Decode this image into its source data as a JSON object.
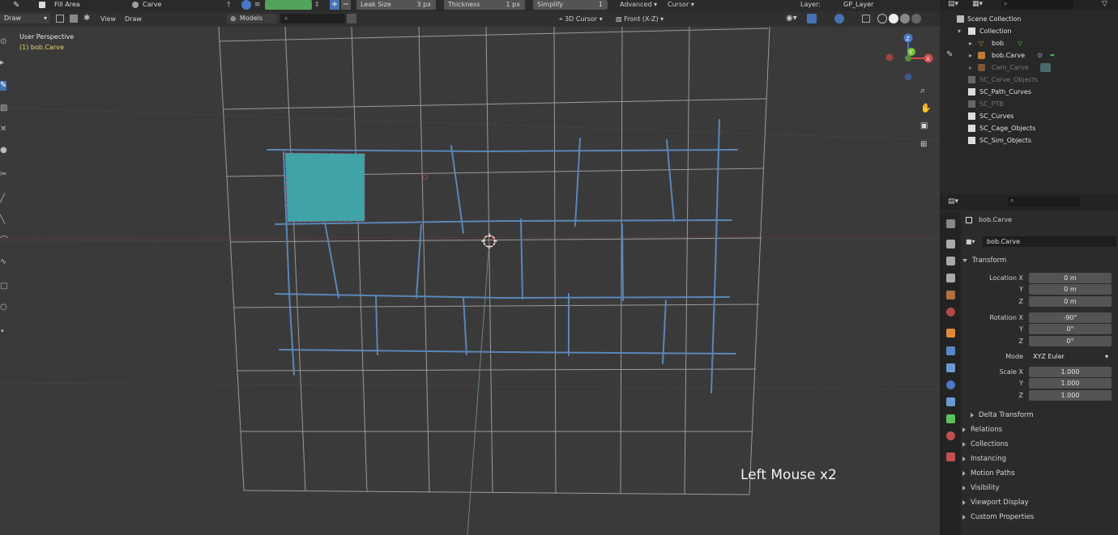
{
  "header": {
    "mode": "Draw",
    "fill_tool": "Fill Area",
    "material": "Carve",
    "leak_size_label": "Leak Size",
    "leak_size_value": "3 px",
    "thickness_label": "Thickness",
    "thickness_value": "1 px",
    "simplify_label": "Simplify",
    "simplify_value": "1",
    "advanced": "Advanced",
    "cursor": "Cursor",
    "layer_label": "Layer:",
    "layer_value": "GP_Layer",
    "fill_color": "#53a35a",
    "menus": [
      "View",
      "Draw"
    ],
    "models": "Models",
    "cursor_3d": "3D Cursor",
    "front_view": "Front (X-Z)"
  },
  "viewport": {
    "perspective": "User Perspective",
    "object": "(1) bob.Carve",
    "hint": "Left Mouse x2",
    "fill_color": "#3fa3a8",
    "stroke_color": "#5a86b8",
    "gizmo": {
      "x": "X",
      "y": "Y",
      "z": "Z"
    }
  },
  "outliner": {
    "root": "Scene Collection",
    "items": [
      {
        "label": "Collection"
      },
      {
        "label": "bob"
      },
      {
        "label": "bob.Carve"
      },
      {
        "label": "Cam_Carve"
      },
      {
        "label": "SC_Carve_Objects"
      },
      {
        "label": "SC_Path_Curves"
      },
      {
        "label": "SC_PTB"
      },
      {
        "label": "SC_Curves"
      },
      {
        "label": "SC_Cage_Objects"
      },
      {
        "label": "SC_Sim_Objects"
      }
    ]
  },
  "properties": {
    "object_name": "bob.Carve",
    "data_name": "bob.Carve",
    "transform_header": "Transform",
    "location": {
      "label_x": "Location X",
      "label_y": "Y",
      "label_z": "Z",
      "x": "0 m",
      "y": "0 m",
      "z": "0 m"
    },
    "rotation": {
      "label_x": "Rotation X",
      "label_y": "Y",
      "label_z": "Z",
      "x": "-90°",
      "y": "0°",
      "z": "0°"
    },
    "mode_label": "Mode",
    "mode_value": "XYZ Euler",
    "scale": {
      "label_x": "Scale X",
      "label_y": "Y",
      "label_z": "Z",
      "x": "1.000",
      "y": "1.000",
      "z": "1.000"
    },
    "sections": [
      "Delta Transform",
      "Relations",
      "Collections",
      "Instancing",
      "Motion Paths",
      "Visibility",
      "Viewport Display",
      "Custom Properties"
    ]
  }
}
